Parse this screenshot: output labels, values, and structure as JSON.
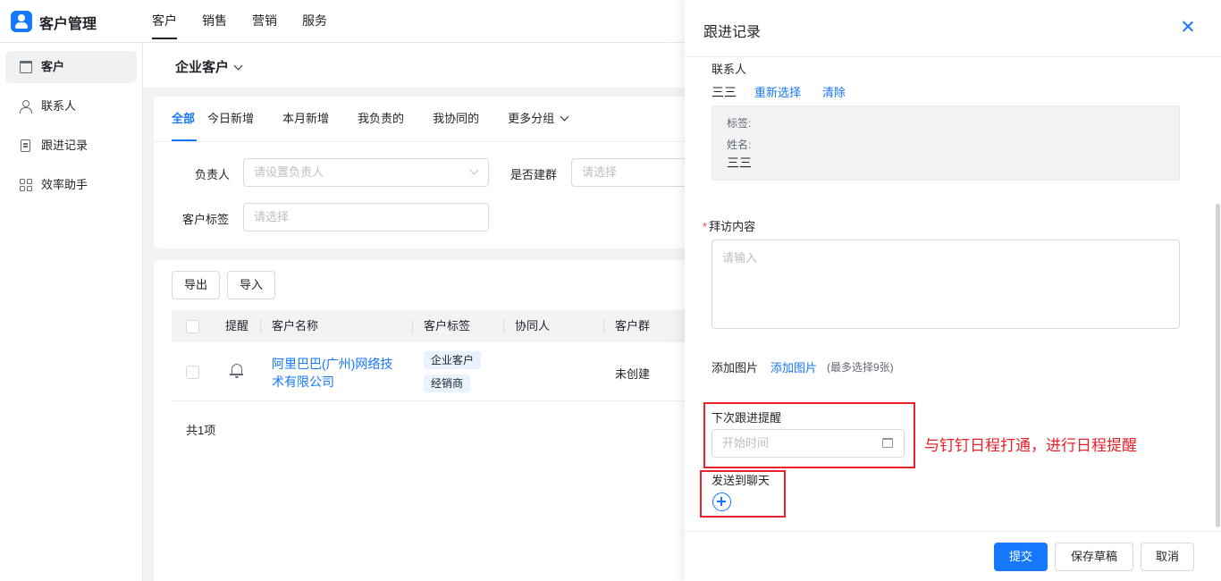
{
  "app": {
    "title": "客户管理"
  },
  "topnav": [
    "客户",
    "销售",
    "营销",
    "服务"
  ],
  "sidebar": {
    "items": [
      {
        "label": "客户",
        "icon": "building-icon"
      },
      {
        "label": "联系人",
        "icon": "user-icon"
      },
      {
        "label": "跟进记录",
        "icon": "document-icon"
      },
      {
        "label": "效率助手",
        "icon": "grid-icon"
      }
    ]
  },
  "main": {
    "title": "企业客户",
    "tabs": [
      "全部",
      "今日新增",
      "本月新增",
      "我负责的",
      "我协同的",
      "更多分组"
    ],
    "filters": {
      "owner_label": "负责人",
      "owner_placeholder": "请设置负责人",
      "group_label": "是否建群",
      "group_placeholder": "请选择",
      "tag_label": "客户标签",
      "tag_placeholder": "请选择"
    },
    "buttons": {
      "export": "导出",
      "import": "导入"
    },
    "table": {
      "headers": [
        "提醒",
        "客户名称",
        "客户标签",
        "协同人",
        "客户群"
      ],
      "rows": [
        {
          "name": "阿里巴巴(广州)网络技术有限公司",
          "tags": [
            "企业客户",
            "经销商"
          ],
          "group": "未创建"
        }
      ],
      "total": "共1项"
    }
  },
  "drawer": {
    "title": "跟进记录",
    "contact_label": "联系人",
    "contact_value": "三三",
    "reselect": "重新选择",
    "clear": "清除",
    "info_tag_label": "标签:",
    "info_name_label": "姓名:",
    "info_name_value": "三三",
    "visit_required": "*",
    "visit_label": "拜访内容",
    "visit_placeholder": "请输入",
    "image_label": "添加图片",
    "image_link": "添加图片",
    "image_hint": "(最多选择9张)",
    "reminder_label": "下次跟进提醒",
    "reminder_placeholder": "开始时间",
    "send_label": "发送到聊天",
    "annotation": "与钉钉日程打通，进行日程提醒",
    "footer": {
      "submit": "提交",
      "save_draft": "保存草稿",
      "cancel": "取消"
    }
  },
  "colors": {
    "accent": "#1677ff",
    "annotation": "#e8222d",
    "tag_bg": "#e8f3ff"
  }
}
